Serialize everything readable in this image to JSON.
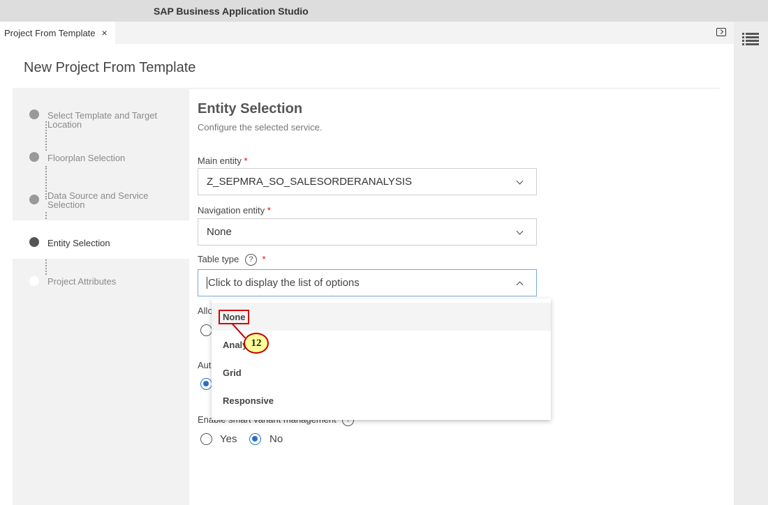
{
  "app": {
    "title": "SAP Business Application Studio"
  },
  "tabs": [
    {
      "label": "Project From Template",
      "close": "×"
    }
  ],
  "page": {
    "title": "New Project From Template"
  },
  "steps": [
    {
      "label": "Select Template and Target Location",
      "state": "done"
    },
    {
      "label": "Floorplan Selection",
      "state": "done"
    },
    {
      "label": "Data Source and Service Selection",
      "state": "done"
    },
    {
      "label": "Entity Selection",
      "state": "active"
    },
    {
      "label": "Project Attributes",
      "state": "future"
    }
  ],
  "main": {
    "title": "Entity Selection",
    "subtitle": "Configure the selected service.",
    "main_entity": {
      "label": "Main entity",
      "required": "*",
      "value": "Z_SEPMRA_SO_SALESORDERANALYSIS"
    },
    "navigation_entity": {
      "label": "Navigation entity",
      "required": "*",
      "value": "None"
    },
    "table_type": {
      "label": "Table type",
      "help": "?",
      "required": "*",
      "placeholder": "Click to display the list of options"
    },
    "partial_label_1": "Allo",
    "partial_label_2": "Aut",
    "smart_variant": {
      "label": "Enable smart variant management",
      "help": "?",
      "options": [
        {
          "label": "Yes",
          "checked": false
        },
        {
          "label": "No",
          "checked": true
        }
      ]
    }
  },
  "dropdown": {
    "options": [
      "None",
      "Analytical",
      "Grid",
      "Responsive"
    ],
    "highlighted": "None"
  },
  "callout": {
    "number": "12"
  },
  "colors": {
    "accent": "#2a6fc9",
    "highlight": "#d40000",
    "callout_fill": "#ffff99"
  }
}
